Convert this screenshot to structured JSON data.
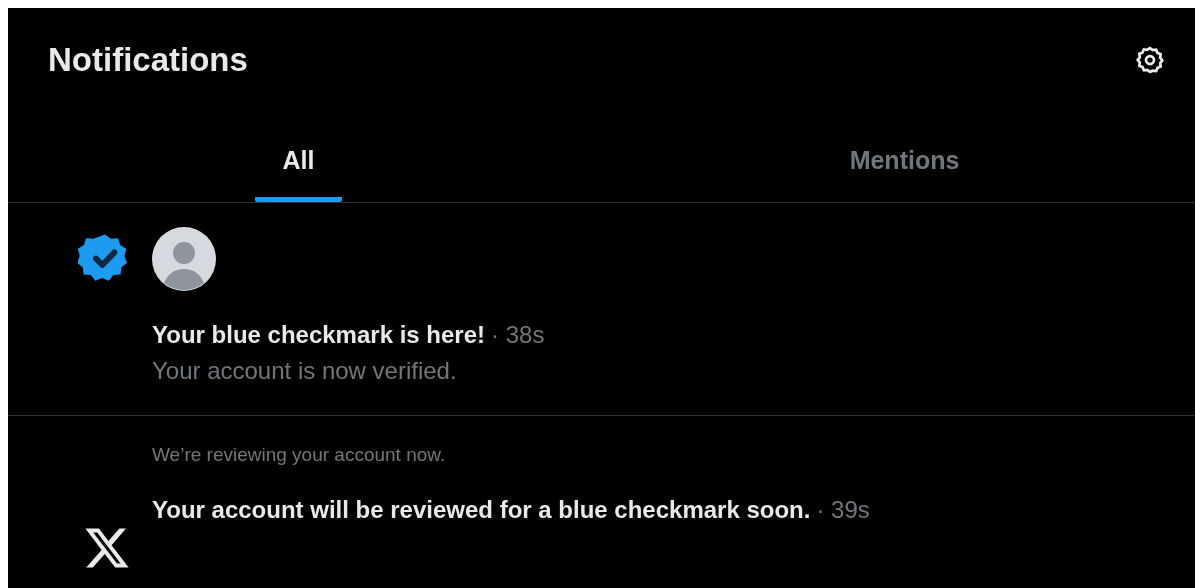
{
  "header": {
    "title": "Notifications"
  },
  "tabs": [
    {
      "label": "All",
      "selected": true
    },
    {
      "label": "Mentions",
      "selected": false
    }
  ],
  "notifications": [
    {
      "kind": "verified",
      "title": "Your blue checkmark is here!",
      "time": "· 38s",
      "body": "Your account is now verified."
    },
    {
      "kind": "system",
      "context": "We’re reviewing your account now.",
      "title": "Your account will be reviewed for a blue checkmark soon.",
      "time": "· 39s"
    }
  ]
}
